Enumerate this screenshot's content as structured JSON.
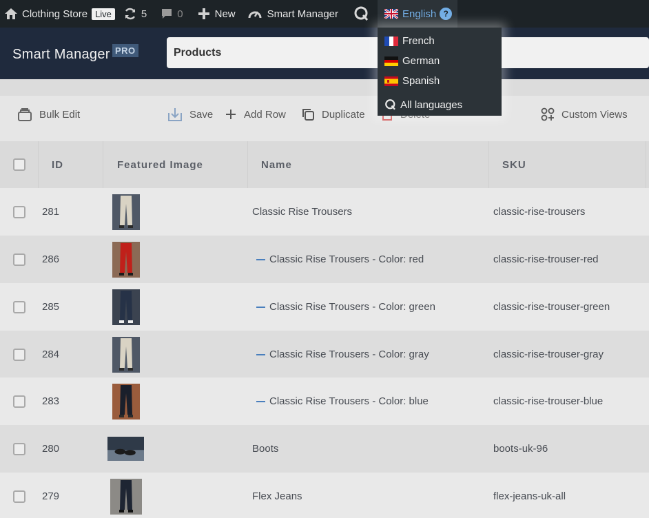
{
  "adminbar": {
    "site_name": "Clothing Store",
    "live_badge": "Live",
    "updates_count": "5",
    "comments_count": "0",
    "new_label": "New",
    "smart_manager_label": "Smart Manager",
    "current_language": "English",
    "help_mark": "?"
  },
  "language_menu": {
    "items": [
      {
        "label": "French"
      },
      {
        "label": "German"
      },
      {
        "label": "Spanish"
      }
    ],
    "all_languages": "All languages"
  },
  "header": {
    "title": "Smart Manager",
    "pro_badge": "PRO",
    "dashboard_select": "Products"
  },
  "toolbar": {
    "bulk_edit": "Bulk Edit",
    "save": "Save",
    "add_row": "Add Row",
    "duplicate": "Duplicate",
    "delete": "Delete",
    "custom_views": "Custom Views"
  },
  "table": {
    "columns": {
      "id": "ID",
      "image": "Featured Image",
      "name": "Name",
      "sku": "SKU"
    },
    "rows": [
      {
        "id": "281",
        "name": "Classic Rise Trousers",
        "sku": "classic-rise-trousers",
        "variation": false,
        "image": "trousers-cream"
      },
      {
        "id": "286",
        "name": "Classic Rise Trousers - Color: red",
        "sku": "classic-rise-trouser-red",
        "variation": true,
        "image": "trousers-red"
      },
      {
        "id": "285",
        "name": "Classic Rise Trousers - Color: green",
        "sku": "classic-rise-trouser-green",
        "variation": true,
        "image": "trousers-navy"
      },
      {
        "id": "284",
        "name": "Classic Rise Trousers - Color: gray",
        "sku": "classic-rise-trouser-gray",
        "variation": true,
        "image": "trousers-cream"
      },
      {
        "id": "283",
        "name": "Classic Rise Trousers - Color: blue",
        "sku": "classic-rise-trouser-blue",
        "variation": true,
        "image": "trousers-dark"
      },
      {
        "id": "280",
        "name": "Boots",
        "sku": "boots-uk-96",
        "variation": false,
        "image": "boots-photo"
      },
      {
        "id": "279",
        "name": "Flex Jeans",
        "sku": "flex-jeans-uk-all",
        "variation": false,
        "image": "jeans-dark"
      }
    ]
  },
  "colors": {
    "admin_bar": "#1d2327",
    "header": "#1f2a3d",
    "link_blue": "#72aee6",
    "variation_dash": "#4a7fbd"
  }
}
